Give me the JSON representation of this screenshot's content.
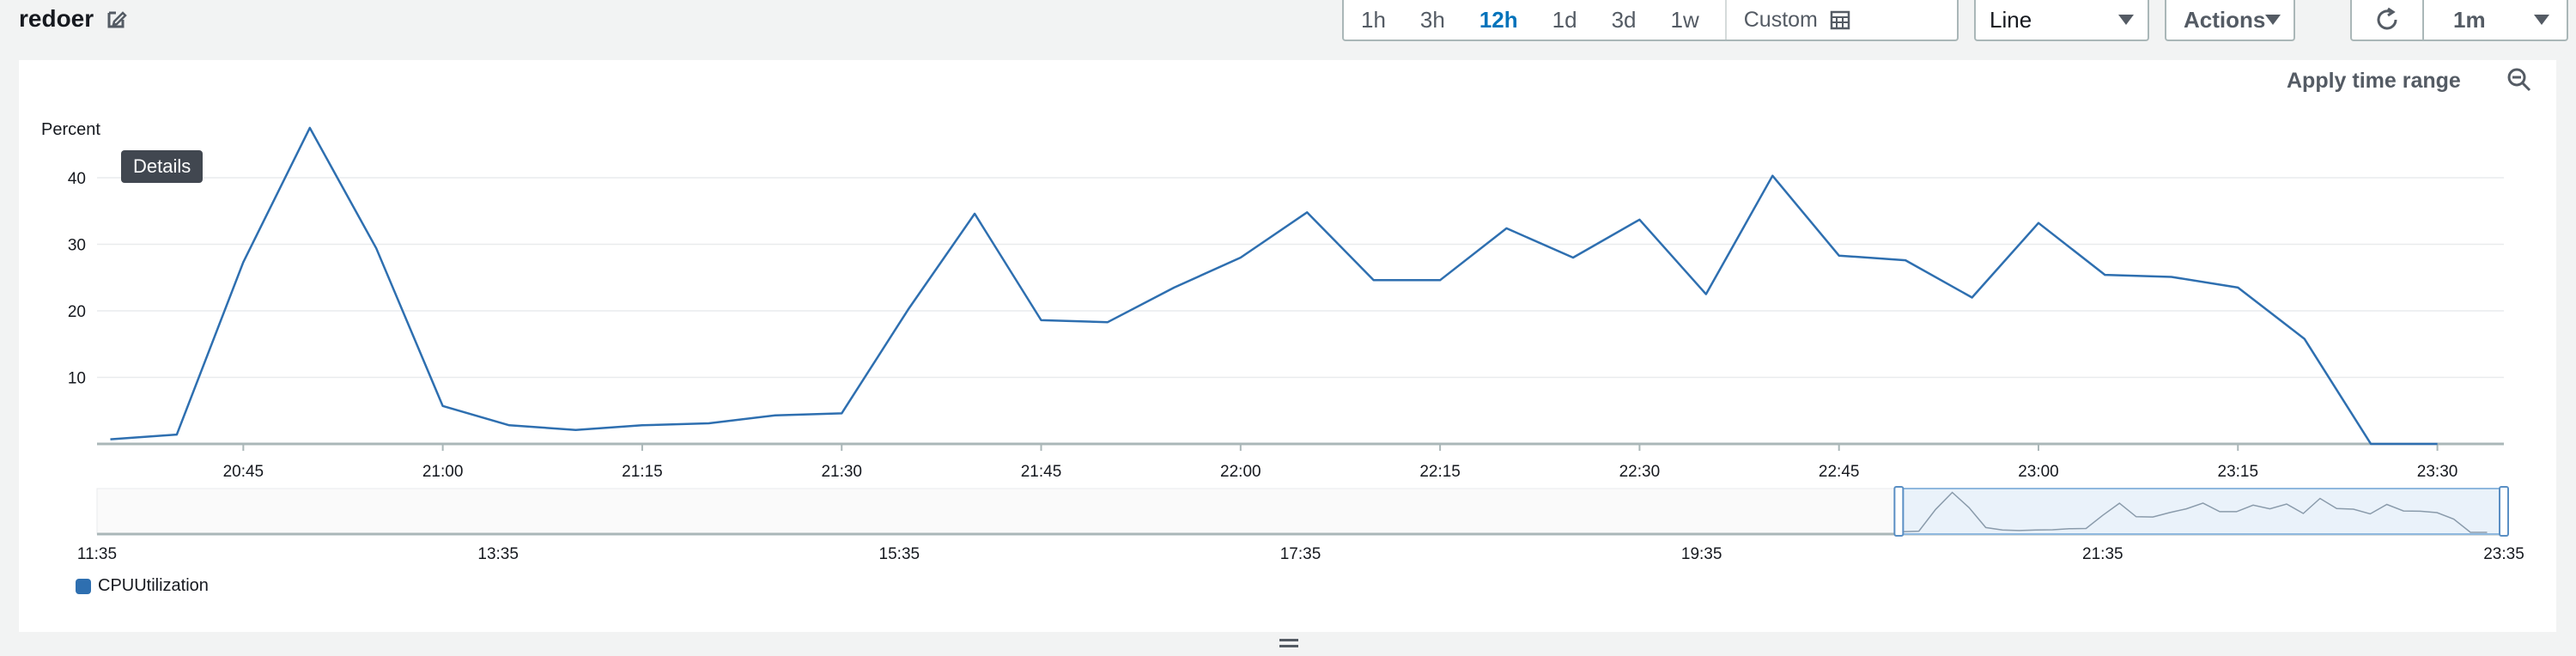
{
  "widget": {
    "title": "redoer",
    "time_ranges": [
      "1h",
      "3h",
      "12h",
      "1d",
      "3d",
      "1w"
    ],
    "active_range": "12h",
    "custom_label": "Custom",
    "view_type": "Line",
    "actions_label": "Actions",
    "refresh_interval": "1m",
    "apply_time_range": "Apply time range",
    "tooltip": "Details"
  },
  "colors": {
    "series": "#2e6fb0",
    "active": "#0073bb",
    "grid": "#e9ebed"
  },
  "icons": [
    "edit-icon",
    "calendar-icon",
    "refresh-icon",
    "zoom-out-icon"
  ],
  "chart_data": {
    "type": "line",
    "ylabel": "Percent",
    "ylim": [
      0,
      48
    ],
    "yticks": [
      10,
      20,
      30,
      40
    ],
    "x_ticks": [
      "20:45",
      "21:00",
      "21:15",
      "21:30",
      "21:45",
      "22:00",
      "22:15",
      "22:30",
      "22:45",
      "23:00",
      "23:15",
      "23:30"
    ],
    "x_range": [
      "20:34",
      "23:35"
    ],
    "grid": true,
    "series": [
      {
        "name": "CPUUtilization",
        "x": [
          "20:35",
          "20:40",
          "20:45",
          "20:50",
          "20:55",
          "21:00",
          "21:05",
          "21:10",
          "21:15",
          "21:20",
          "21:25",
          "21:30",
          "21:35",
          "21:40",
          "21:45",
          "21:50",
          "21:55",
          "22:00",
          "22:05",
          "22:10",
          "22:15",
          "22:20",
          "22:25",
          "22:30",
          "22:35",
          "22:40",
          "22:45",
          "22:50",
          "22:55",
          "23:00",
          "23:05",
          "23:10",
          "23:15",
          "23:20",
          "23:25",
          "23:30"
        ],
        "values": [
          0.7,
          1.4,
          27.3,
          47.5,
          29.4,
          5.7,
          2.8,
          2.1,
          2.8,
          3.1,
          4.3,
          4.6,
          20.2,
          34.6,
          18.6,
          18.3,
          23.5,
          28.0,
          34.8,
          24.6,
          24.6,
          32.4,
          28.0,
          33.7,
          22.5,
          40.3,
          28.3,
          27.6,
          22.0,
          33.2,
          25.4,
          25.1,
          23.5,
          15.8,
          0.0,
          0.0
        ]
      }
    ],
    "overview": {
      "x_ticks": [
        "11:35",
        "13:35",
        "15:35",
        "17:35",
        "19:35",
        "21:35",
        "23:35"
      ],
      "x_range": [
        "11:35",
        "23:35"
      ],
      "selection": [
        "20:34",
        "23:35"
      ]
    },
    "legend": [
      "CPUUtilization"
    ],
    "legend_position": "bottom-left"
  }
}
